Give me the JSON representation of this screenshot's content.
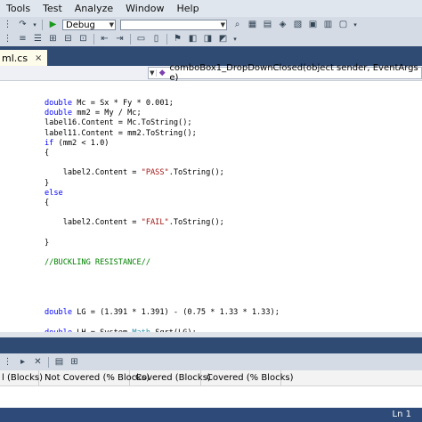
{
  "menu": [
    "Tools",
    "Test",
    "Analyze",
    "Window",
    "Help"
  ],
  "toolbar": {
    "config_value": "Debug",
    "platform_value": ""
  },
  "doc_tab": {
    "label": "ml.cs",
    "close": "×"
  },
  "navbar": {
    "member": "comboBox1_DropDownClosed(object sender, EventArgs e)"
  },
  "code_lines": [
    [
      [
        "",
        "double Mc = Sx * Fy * 0.001;"
      ]
    ],
    [
      [
        "",
        "double mm2 = My / Mc;"
      ]
    ],
    [
      [
        "",
        "label16.Content = Mc.ToString();"
      ]
    ],
    [
      [
        "",
        "label11.Content = mm2.ToString();"
      ]
    ],
    [
      [
        "",
        "if (mm2 < 1.0)"
      ]
    ],
    [
      [
        "",
        "{"
      ]
    ],
    [
      [
        "",
        ""
      ]
    ],
    [
      [
        "",
        "    label2.Content = \"PASS\".ToString();"
      ]
    ],
    [
      [
        "",
        "}"
      ]
    ],
    [
      [
        "",
        "else"
      ]
    ],
    [
      [
        "",
        "{"
      ]
    ],
    [
      [
        "",
        ""
      ]
    ],
    [
      [
        "",
        "    label2.Content = \"FAIL\".ToString();"
      ]
    ],
    [
      [
        "",
        ""
      ]
    ],
    [
      [
        "",
        "}"
      ]
    ],
    [
      [
        "",
        ""
      ]
    ],
    [
      [
        "",
        "//BUCKLING RESISTANCE//"
      ]
    ],
    [
      [
        "",
        ""
      ]
    ],
    [
      [
        "",
        ""
      ]
    ],
    [
      [
        "",
        ""
      ]
    ],
    [
      [
        "",
        ""
      ]
    ],
    [
      [
        "",
        "double LG = (1.391 * 1.391) - (0.75 * 1.33 * 1.33);"
      ]
    ],
    [
      [
        "",
        ""
      ]
    ],
    [
      [
        "",
        "double LH = System.Math.Sqrt(LG);"
      ]
    ]
  ],
  "coverage": {
    "columns": [
      "l (Blocks)",
      "Not Covered (% Blocks)",
      "Covered (Blocks)",
      "Covered (% Blocks)"
    ]
  },
  "status": {
    "line": "Ln 1"
  }
}
